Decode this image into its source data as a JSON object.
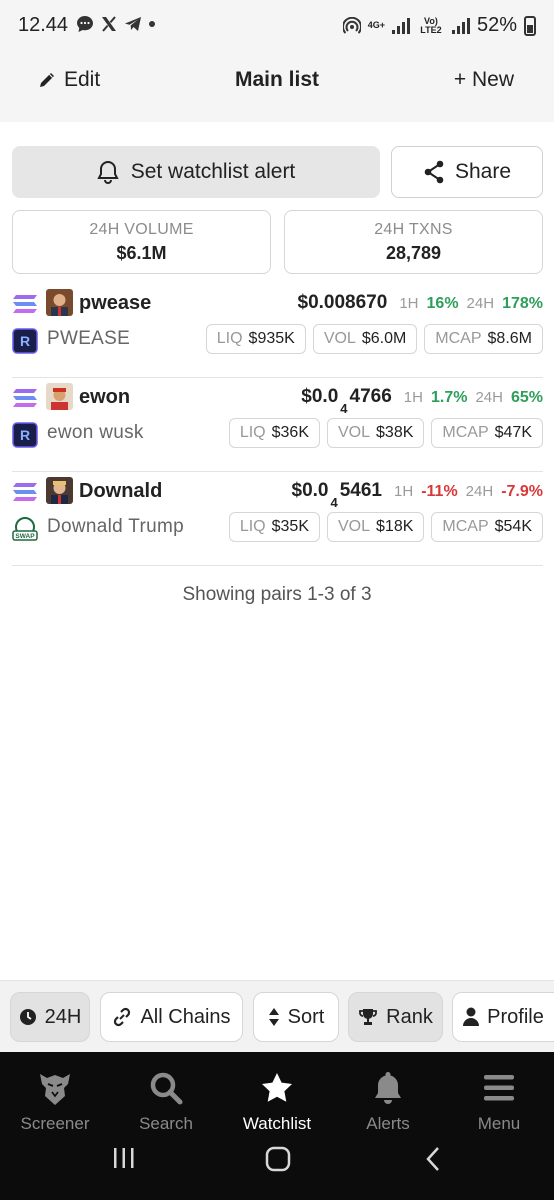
{
  "status_bar": {
    "time": "12.44",
    "network": "4G+",
    "volte": "Vo) LTE2",
    "battery": "52%"
  },
  "header": {
    "edit_label": "Edit",
    "title": "Main list",
    "new_label": "+ New"
  },
  "actions": {
    "alert_label": "Set watchlist alert",
    "share_label": "Share"
  },
  "stats": [
    {
      "label": "24H VOLUME",
      "value": "$6.1M"
    },
    {
      "label": "24H TXNS",
      "value": "28,789"
    }
  ],
  "pairs": [
    {
      "symbol": "pwease",
      "name": "PWEASE",
      "price_prefix": "$0.008670",
      "price_zeros": "",
      "price_rest": "",
      "h1_label": "1H",
      "h1": "16%",
      "h24_label": "24H",
      "h24": "178%",
      "liq_label": "LIQ",
      "liq": "$935K",
      "vol_label": "VOL",
      "vol": "$6.0M",
      "mcap_label": "MCAP",
      "mcap": "$8.6M"
    },
    {
      "symbol": "ewon",
      "name": "ewon wusk",
      "price_prefix": "$0.0",
      "price_zeros": "4",
      "price_rest": "4766",
      "h1_label": "1H",
      "h1": "1.7%",
      "h24_label": "24H",
      "h24": "65%",
      "liq_label": "LIQ",
      "liq": "$36K",
      "vol_label": "VOL",
      "vol": "$38K",
      "mcap_label": "MCAP",
      "mcap": "$47K"
    },
    {
      "symbol": "Downald",
      "name": "Downald Trump",
      "price_prefix": "$0.0",
      "price_zeros": "4",
      "price_rest": "5461",
      "h1_label": "1H",
      "h1": "-11%",
      "h24_label": "24H",
      "h24": "-7.9%",
      "liq_label": "LIQ",
      "liq": "$35K",
      "vol_label": "VOL",
      "vol": "$18K",
      "mcap_label": "MCAP",
      "mcap": "$54K"
    }
  ],
  "showing_text": "Showing pairs 1-3 of 3",
  "filters": {
    "timeframe": "24H",
    "chains": "All Chains",
    "sort": "Sort",
    "rank": "Rank",
    "profile": "Profile"
  },
  "nav": {
    "screener": "Screener",
    "search": "Search",
    "watchlist": "Watchlist",
    "alerts": "Alerts",
    "menu": "Menu"
  },
  "colors": {
    "positive": "#2e9e5b",
    "negative": "#d93838",
    "nav_bg": "#0c0c0c"
  },
  "swap_badge": "SWAP"
}
